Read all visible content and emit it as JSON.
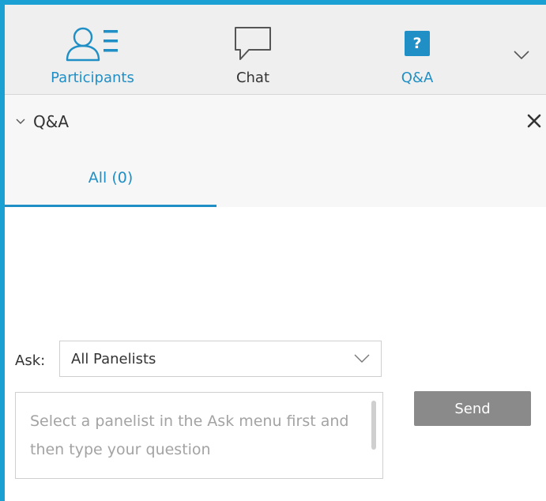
{
  "tabs": [
    {
      "label": "Participants",
      "icon": "participants-icon",
      "active": false
    },
    {
      "label": "Chat",
      "icon": "chat-bubble-icon",
      "active": false
    },
    {
      "label": "Q&A",
      "icon": "question-mark-icon",
      "badge": "?",
      "active": true
    }
  ],
  "panel": {
    "title": "Q&A",
    "subtabs": [
      {
        "label": "All (0)",
        "active": true
      }
    ]
  },
  "ask": {
    "label": "Ask:",
    "selected": "All Panelists"
  },
  "question": {
    "placeholder": "Select a panelist in the Ask menu first and then type your question"
  },
  "send_label": "Send",
  "colors": {
    "accent": "#1f8fc6",
    "frame_border": "#1aa0d2",
    "send_button": "#8a8a8a"
  }
}
